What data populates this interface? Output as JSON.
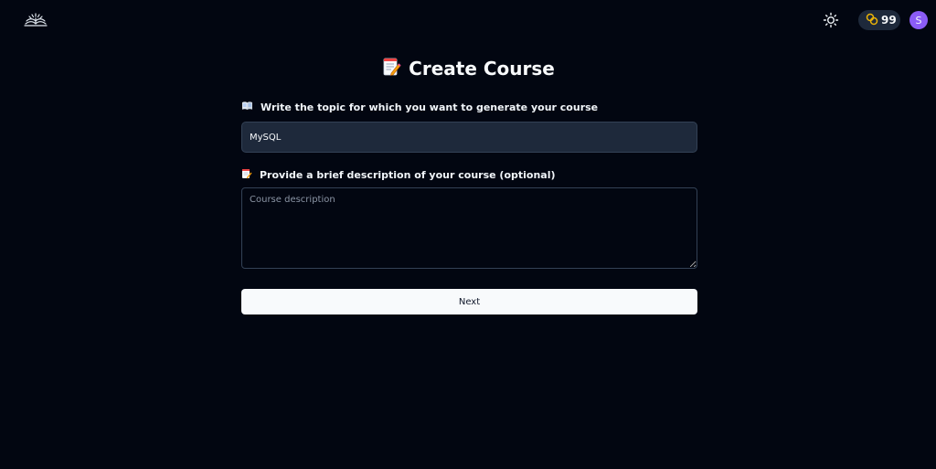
{
  "header": {
    "logo_icon": "open-book-logo-icon",
    "theme_icon": "sun-icon",
    "credits": {
      "icon": "coins-icon",
      "count": "99",
      "accent": "#eab308"
    },
    "avatar": {
      "initial": "S",
      "color": "#8b5cf6"
    }
  },
  "page": {
    "title_icon": "memo-icon",
    "title": "Create Course"
  },
  "form": {
    "topic": {
      "label_icon": "open-book-icon",
      "label": "Write the topic for which you want to generate your course",
      "value": "MySQL"
    },
    "description": {
      "label_icon": "memo-icon",
      "label": "Provide a brief description of your course (optional)",
      "placeholder": "Course description"
    },
    "next_label": "Next"
  },
  "colors": {
    "background": "#020611",
    "input_background": "#1e293b",
    "border": "#334155",
    "button_background": "#f8fafc"
  }
}
